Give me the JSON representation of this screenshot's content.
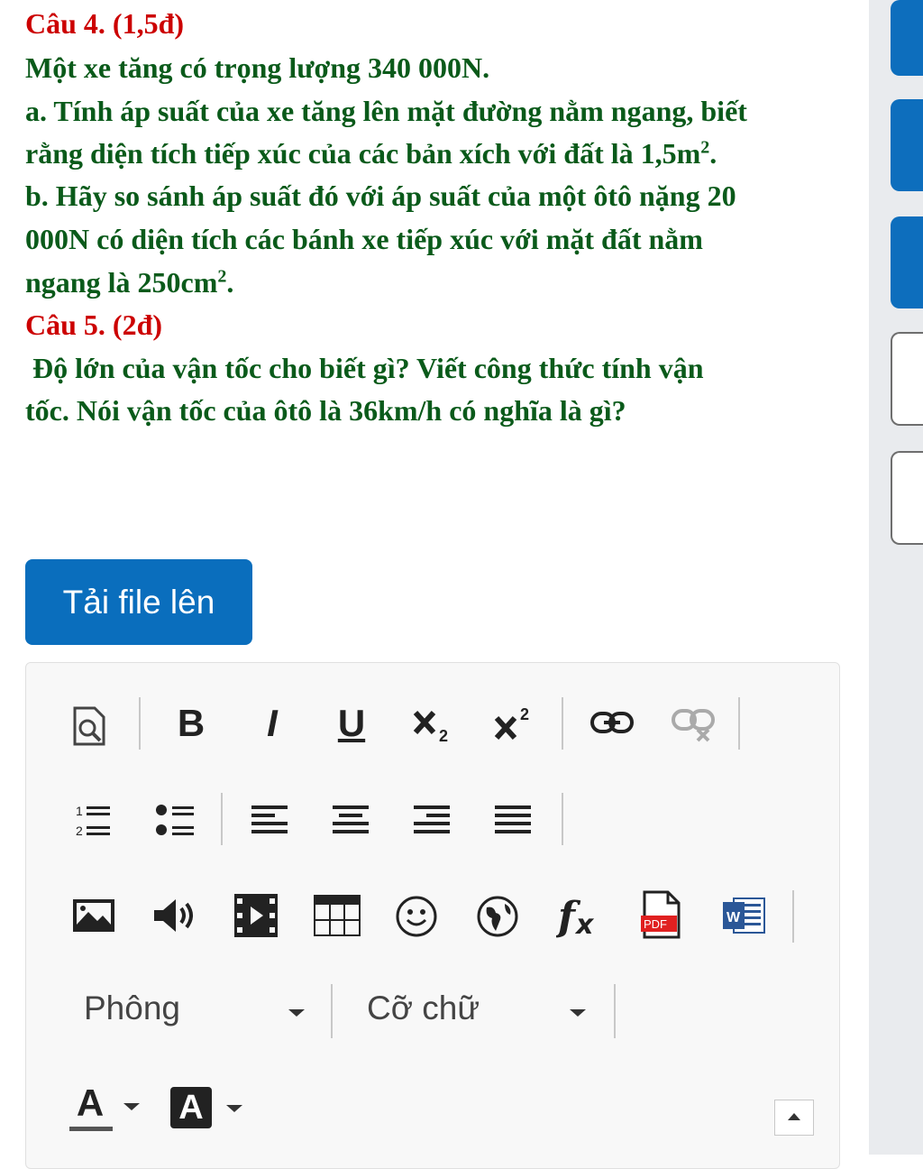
{
  "question4": {
    "heading": "Câu 4. (1,5đ)",
    "line1": "Một xe tăng có trọng lượng 340 000N.",
    "part_a_line1": "a. Tính áp suất của xe tăng lên mặt đường nằm ngang, biết",
    "part_a_line2_pre": "rằng diện tích tiếp xúc của các bản xích với đất là 1,5m",
    "part_a_sup": "2",
    "part_a_end": ".",
    "part_b_line1": "b. Hãy so sánh áp suất đó với áp suất của một ôtô nặng 20",
    "part_b_line2": "000N có diện tích các bánh xe tiếp xúc với mặt đất nằm",
    "part_b_line3_pre": "ngang là 250cm",
    "part_b_sup": "2",
    "part_b_end": "."
  },
  "question5": {
    "heading": "Câu 5. (2đ)",
    "line1": " Độ lớn của vận tốc cho biết gì? Viết công thức tính vận",
    "line2": "tốc. Nói vận tốc của ôtô là 36km/h có nghĩa là gì?"
  },
  "upload_button": {
    "label": "Tải file lên"
  },
  "editor": {
    "toolbar_row1": {
      "bold": "B",
      "italic": "I",
      "underline": "U"
    },
    "dropdowns": {
      "font": "Phông",
      "size": "Cỡ chữ"
    },
    "font_color": "A",
    "bg_color": "A",
    "pdf_label": "PDF",
    "word_label": "W"
  },
  "colors": {
    "heading_red": "#cc0000",
    "text_green": "#0a5a1a",
    "accent_blue": "#0a6ebd"
  }
}
